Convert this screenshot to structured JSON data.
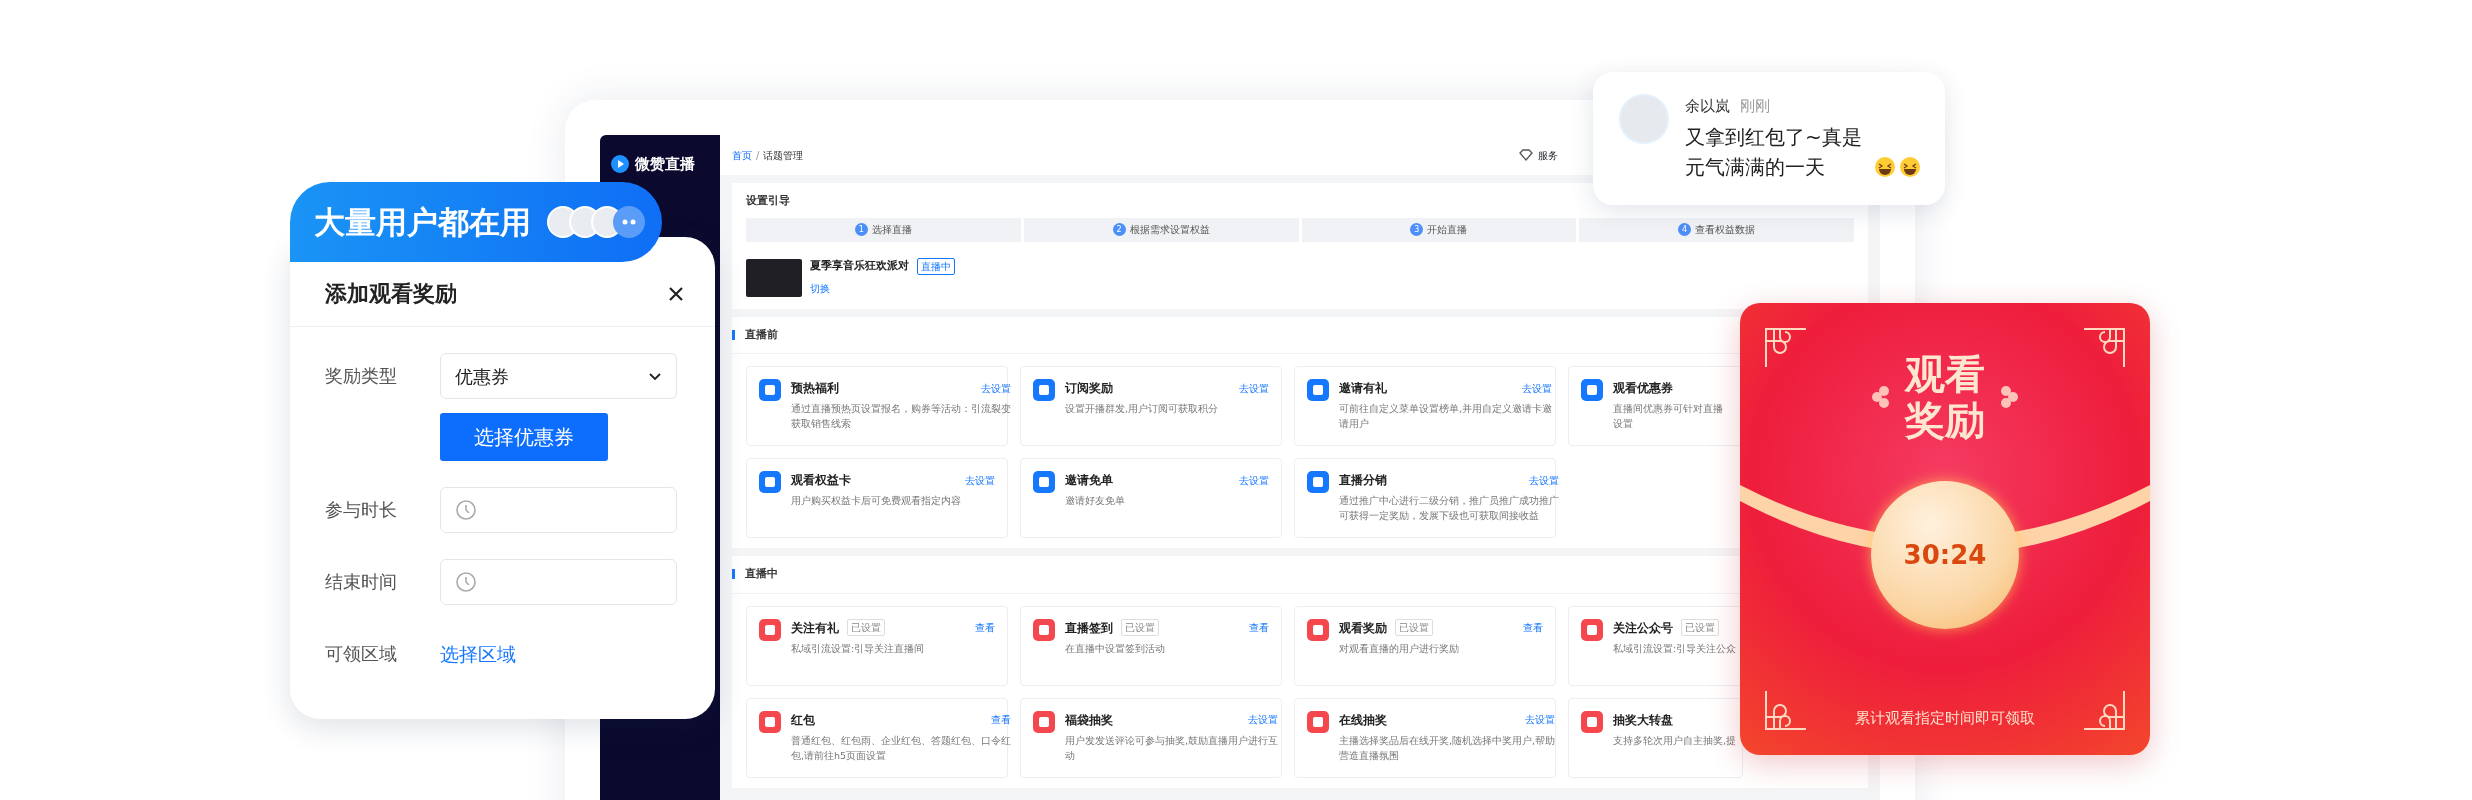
{
  "promo_banner": {
    "title": "大量用户都在用"
  },
  "reward_dialog": {
    "title": "添加观看奖励",
    "fields": [
      {
        "kind": "select",
        "label": "奖励类型",
        "value": "优惠券",
        "button": "选择优惠券"
      },
      {
        "kind": "time",
        "label": "参与时长"
      },
      {
        "kind": "time",
        "label": "结束时间"
      },
      {
        "kind": "link",
        "label": "可领区域",
        "value": "选择区域"
      }
    ]
  },
  "app": {
    "logo": "微赞直播",
    "breadcrumb": {
      "items": [
        "首页",
        "话题管理"
      ],
      "separator": "/"
    },
    "header_link": "服务",
    "guide": {
      "title": "设置引导",
      "steps": [
        {
          "number": "1",
          "label": "选择直播"
        },
        {
          "number": "2",
          "label": "根据需求设置权益"
        },
        {
          "number": "3",
          "label": "开始直播"
        },
        {
          "number": "4",
          "label": "查看权益数据"
        }
      ],
      "live": {
        "title": "夏季享音乐狂欢派对",
        "status": "直播中",
        "switch": "切换"
      }
    },
    "sections": [
      {
        "title": "直播前",
        "color": "#1677ff",
        "cards": [
          {
            "title": "预热福利",
            "action": "去设置",
            "desc": [
              "通过直播预热页设置报名，购券等活动：引流裂变",
              "获取销售线索"
            ]
          },
          {
            "title": "订阅奖励",
            "action": "去设置",
            "desc": [
              "设置开播群发,用户订阅可获取积分"
            ]
          },
          {
            "title": "邀请有礼",
            "action": "去设置",
            "desc": [
              "可前往自定义菜单设置榜单,并用自定义邀请卡邀",
              "请用户"
            ]
          },
          {
            "title": "观看优惠券",
            "desc": [
              "直播间优惠券可针对直播",
              "设置"
            ]
          },
          {
            "title": "观看权益卡",
            "action": "去设置",
            "desc": [
              "用户购买权益卡后可免费观看指定内容"
            ]
          },
          {
            "title": "邀请免单",
            "action": "去设置",
            "desc": [
              "邀请好友免单"
            ]
          },
          {
            "title": "直播分销",
            "action": "去设置",
            "desc": [
              "通过推广中心进行二级分销，推广员推广成功推广",
              "可获得一定奖励，发展下级也可获取间接收益"
            ]
          }
        ]
      },
      {
        "title": "直播中",
        "color": "#f5474e",
        "cards": [
          {
            "title": "关注有礼",
            "tag": "已设置",
            "action": "查看",
            "desc": [
              "私域引流设置:引导关注直播间"
            ]
          },
          {
            "title": "直播签到",
            "tag": "已设置",
            "action": "查看",
            "desc": [
              "在直播中设置签到活动"
            ]
          },
          {
            "title": "观看奖励",
            "tag": "已设置",
            "action": "查看",
            "desc": [
              "对观看直播的用户进行奖励"
            ]
          },
          {
            "title": "关注公众号",
            "tag": "已设置",
            "desc": [
              "私域引流设置:引导关注公众"
            ]
          },
          {
            "title": "红包",
            "action": "查看",
            "desc": [
              "普通红包、红包雨、企业红包、答题红包、口令红",
              "包,请前往h5页面设置"
            ]
          },
          {
            "title": "福袋抽奖",
            "action": "去设置",
            "desc": [
              "用户发发送评论可参与抽奖,鼓励直播用户进行互",
              "动"
            ]
          },
          {
            "title": "在线抽奖",
            "action": "去设置",
            "desc": [
              "主播选择奖品后在线开奖,随机选择中奖用户,帮助",
              "营造直播氛围"
            ]
          },
          {
            "title": "抽奖大转盘",
            "desc": [
              "支持多轮次用户自主抽奖,提"
            ]
          }
        ]
      }
    ]
  },
  "comment": {
    "name": "余以岚",
    "time": "刚刚",
    "text": "又拿到红包了~真是元气满满的一天"
  },
  "envelope": {
    "title": "观看奖励",
    "timer": "30:24",
    "caption": "累计观看指定时间即可领取"
  }
}
